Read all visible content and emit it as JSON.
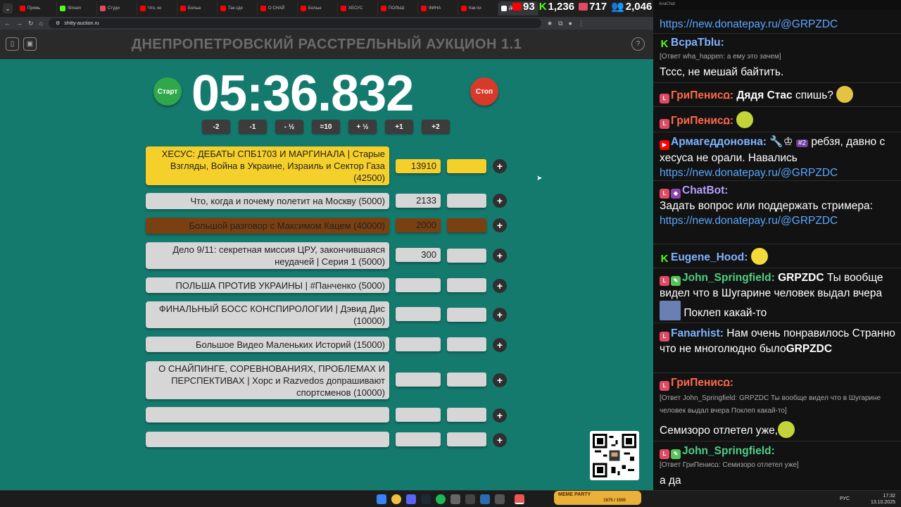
{
  "browser": {
    "tabs": [
      "Прямь",
      "Stream",
      "Студи",
      "Что, ко",
      "Больш",
      "Так сде",
      "О СНАЙ",
      "Больш",
      "ХЕСУС",
      "ПОЛЬШ",
      "ФИНА",
      "Как пи",
      "Дн"
    ],
    "url": "shitty-auction.ru",
    "stats": [
      "93",
      "1,236",
      "717",
      "2,046"
    ]
  },
  "app": {
    "title": "ДНЕПРОПЕТРОВСКИЙ РАССТРЕЛЬНЫЙ АУКЦИОН 1.1",
    "timer": "05:36.832",
    "start_label": "Старт",
    "stop_label": "Стоп",
    "adjust": [
      "-2",
      "-1",
      "- ½",
      "=10",
      "+ ½",
      "+1",
      "+2"
    ],
    "plus_label": "+",
    "lots": [
      {
        "name": "ХЕСУС: ДЕБАТЫ СПБ1703 И МАРГИНАЛА | Старые Взгляды, Война в Украине, Израиль и Сектор Газа (42500)",
        "amount": "13910",
        "color": "#f6d02a"
      },
      {
        "name": "Что, когда и почему полетит на Москву (5000)",
        "amount": "2133",
        "color": "#d6d6d6"
      },
      {
        "name": "Большой разговор с Максимом Кацем (40000)",
        "amount": "2000",
        "color": "#7b4011"
      },
      {
        "name": "Дело 9/11: секретная миссия ЦРУ, закончившаяся неудачей | Серия 1 (5000)",
        "amount": "300",
        "color": "#d6d6d6"
      },
      {
        "name": "ПОЛЬША ПРОТИВ УКРАИНЫ | #Панченко (5000)",
        "amount": "",
        "color": "#d6d6d6"
      },
      {
        "name": "ФИНАЛЬНЫЙ БОСС КОНСПИРОЛОГИИ | Дэвид Дис (10000)",
        "amount": "",
        "color": "#d6d6d6"
      },
      {
        "name": "Большое Видео Маленьких Историй (15000)",
        "amount": "",
        "color": "#d6d6d6"
      },
      {
        "name": "О СНАЙПИНГЕ, СОРЕВНОВАНИЯХ, ПРОБЛЕМАХ И ПЕРСПЕКТИВАХ | Хорс и Razvedos допрашивают спортсменов (10000)",
        "amount": "",
        "color": "#d6d6d6"
      },
      {
        "name": "",
        "amount": "",
        "color": "#d6d6d6"
      },
      {
        "name": "",
        "amount": "",
        "color": "#d6d6d6"
      }
    ]
  },
  "chat": {
    "title": "AvaChat",
    "link": "https://new.donatepay.ru/@GRPZDC",
    "m1": {
      "user": "ВсраТblu:",
      "reply": "[Ответ wha_happen: а ему это зачем]",
      "text": "Тссс, не мешай байтить."
    },
    "m2": {
      "user": "ГриПенисꭥ:",
      "mention": "Дядя Стас",
      "text": "спишь?"
    },
    "m3": {
      "user": "ГриПенисꭥ:"
    },
    "m4": {
      "user": "Армагеддоновна:",
      "badge": "#2",
      "text": "ребзя, давно с хесуса не орали. Навались"
    },
    "m5": {
      "user": "ChatBot:",
      "text": "Задать вопрос или поддержать стримера:"
    },
    "m6": {
      "user": "Eugene_Hood:"
    },
    "m7": {
      "user": "John_Springfield:",
      "mention": "GRPZDC",
      "text1": "Ты вообще видел что в Шугарине человек выдал вчера",
      "text2": "Поклеп какай-то"
    },
    "m8": {
      "user": "Fanarhist:",
      "text": "Нам очень понравилось Странно что не многолюдно было",
      "mention": "GRPZDC"
    },
    "m9": {
      "user": "ГриПенисꭥ:",
      "reply": "[Ответ John_Springfield: GRPZDC Ты вообще видел что в Шугарине человек выдал вчера  Поклеп какай-то]",
      "text": "Семизоро отлетел уже,"
    },
    "m10": {
      "user": "John_Springfield:",
      "reply": "[Ответ ГриПенисꭥ: Семизоро отлетел уже]",
      "text": "а да"
    }
  },
  "taskbar": {
    "meme_title": "MEME PARTY",
    "meme_counter": "1675 / 1500",
    "lang": "РУС",
    "time": "17:32",
    "date": "13.10.2025"
  }
}
